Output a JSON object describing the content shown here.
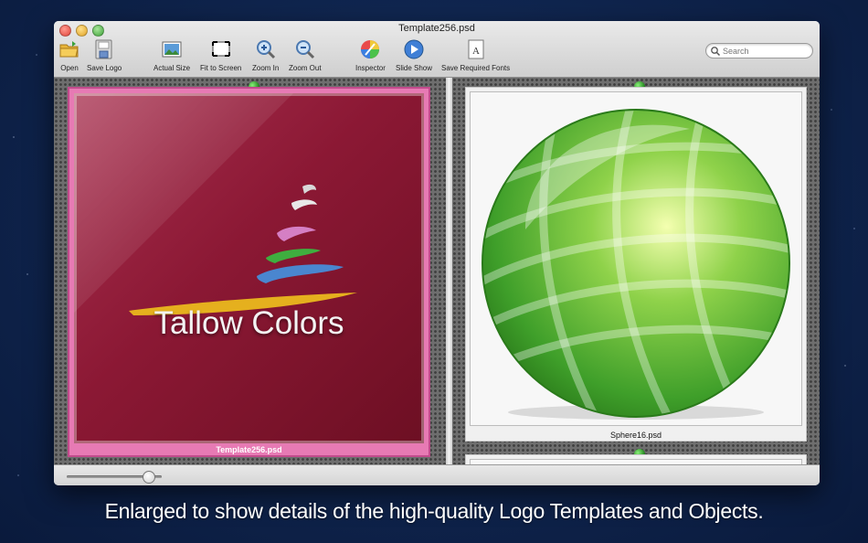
{
  "window": {
    "title": "Template256.psd"
  },
  "toolbar": {
    "buttons": [
      {
        "label": "Open",
        "icon": "folder-icon"
      },
      {
        "label": "Save Logo",
        "icon": "save-disk-icon"
      },
      {
        "label": "Actual Size",
        "icon": "actual-size-icon"
      },
      {
        "label": "Fit to Screen",
        "icon": "fit-screen-icon"
      },
      {
        "label": "Zoom In",
        "icon": "zoom-in-icon"
      },
      {
        "label": "Zoom Out",
        "icon": "zoom-out-icon"
      },
      {
        "label": "Inspector",
        "icon": "color-wheel-icon"
      },
      {
        "label": "Slide Show",
        "icon": "play-icon"
      },
      {
        "label": "Save Required Fonts",
        "icon": "font-document-icon"
      }
    ],
    "search": {
      "placeholder": "Search",
      "value": ""
    }
  },
  "left_item": {
    "logo_text": "Tallow Colors",
    "filename": "Template256.psd",
    "frame_color": "#e77ab4",
    "background_color": "#8b1834"
  },
  "right_item": {
    "filename": "Sphere16.psd",
    "sphere_color": "#3f9f2a"
  },
  "zoom_slider": {
    "value": 0.9
  },
  "caption": "Enlarged to show details of the high-quality Logo Templates and Objects."
}
